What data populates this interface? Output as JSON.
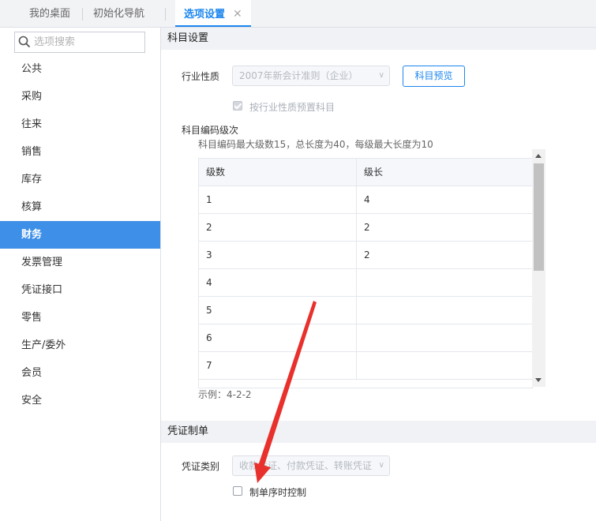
{
  "tabs": [
    {
      "label": "我的桌面",
      "active": false
    },
    {
      "label": "初始化导航",
      "active": false
    },
    {
      "label": "选项设置",
      "active": true,
      "closable": true
    }
  ],
  "tab_close_glyph": "✕",
  "search": {
    "placeholder": "选项搜索",
    "value": ""
  },
  "sidebar": {
    "items": [
      {
        "label": "公共"
      },
      {
        "label": "采购"
      },
      {
        "label": "往来"
      },
      {
        "label": "销售"
      },
      {
        "label": "库存"
      },
      {
        "label": "核算"
      },
      {
        "label": "财务",
        "active": true
      },
      {
        "label": "发票管理"
      },
      {
        "label": "凭证接口"
      },
      {
        "label": "零售"
      },
      {
        "label": "生产/委外"
      },
      {
        "label": "会员"
      },
      {
        "label": "安全"
      }
    ]
  },
  "subject_settings": {
    "title": "科目设置",
    "industry_label": "行业性质",
    "industry_value": "2007年新会计准则（企业）",
    "preview_button": "科目预览",
    "preset_checkbox_label": "按行业性质预置科目",
    "preset_checked": true,
    "code_level_title": "科目编码级次",
    "code_level_hint": "科目编码最大级数15，总长度为40，每级最大长度为10",
    "table": {
      "headers": [
        "级数",
        "级长"
      ],
      "rows": [
        [
          "1",
          "4"
        ],
        [
          "2",
          "2"
        ],
        [
          "3",
          "2"
        ],
        [
          "4",
          ""
        ],
        [
          "5",
          ""
        ],
        [
          "6",
          ""
        ],
        [
          "7",
          ""
        ]
      ]
    },
    "example": "示例：4-2-2"
  },
  "voucher": {
    "title": "凭证制单",
    "type_label": "凭证类别",
    "type_value": "收款凭证、付款凭证、转账凭证",
    "seq_control_label": "制单序时控制",
    "seq_control_checked": false
  },
  "colors": {
    "accent": "#1c86ee",
    "sidebar_active": "#3d8fe8",
    "annotation_arrow": "#e8302c"
  },
  "icons": {
    "search": "search-icon",
    "tab_close": "close-icon",
    "dropdown": "chevron-down-icon"
  }
}
